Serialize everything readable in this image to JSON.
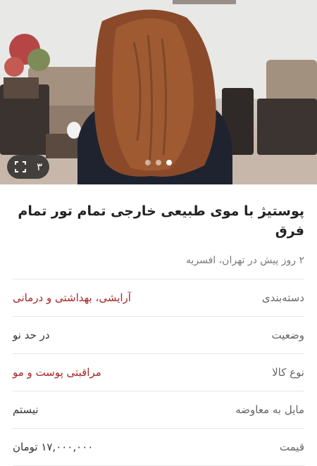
{
  "gallery": {
    "count": "۳",
    "icon": "expand-icon",
    "dots": [
      false,
      false,
      true
    ]
  },
  "listing": {
    "title": "پوستیژ با موی طبیعی خارجی تمام تور تمام فرق",
    "meta": "۲ روز پیش در تهران، افسریه"
  },
  "details": [
    {
      "label": "دسته‌بندی",
      "value": "آرایشی، بهداشتی و درمانی",
      "link": true
    },
    {
      "label": "وضعیت",
      "value": "در حد نو",
      "link": false
    },
    {
      "label": "نوع کالا",
      "value": "مراقبتی پوست و مو",
      "link": true
    },
    {
      "label": "مایل به معاوضه",
      "value": "نیستم",
      "link": false
    },
    {
      "label": "قیمت",
      "value": "۱۷,۰۰۰,۰۰۰ تومان",
      "link": false
    }
  ],
  "colors": {
    "link": "#a62626",
    "label": "#666666",
    "divider": "#e6e6e6"
  }
}
